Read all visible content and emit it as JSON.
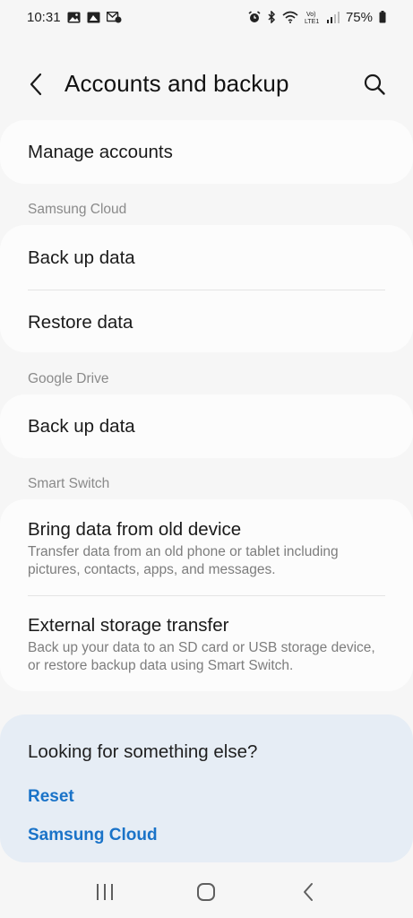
{
  "status_bar": {
    "time": "10:31",
    "battery": "75%",
    "left_icons": [
      "gallery-icon",
      "image-icon",
      "message-icon"
    ],
    "right_icons": [
      "alarm-icon",
      "bluetooth-icon",
      "wifi-icon",
      "volte-icon",
      "signal-icon",
      "battery-icon"
    ],
    "volte_text": "Vo)\nLTE1"
  },
  "header": {
    "title": "Accounts and backup"
  },
  "manage_accounts": {
    "label": "Manage accounts"
  },
  "samsung_cloud": {
    "section_label": "Samsung Cloud",
    "items": [
      {
        "label": "Back up data"
      },
      {
        "label": "Restore data"
      }
    ]
  },
  "google_drive": {
    "section_label": "Google Drive",
    "items": [
      {
        "label": "Back up data"
      }
    ]
  },
  "smart_switch": {
    "section_label": "Smart Switch",
    "items": [
      {
        "label": "Bring data from old device",
        "subtitle": "Transfer data from an old phone or tablet including pictures, contacts, apps, and messages."
      },
      {
        "label": "External storage transfer",
        "subtitle": "Back up your data to an SD card or USB storage device, or restore backup data using Smart Switch."
      }
    ]
  },
  "suggestions": {
    "title": "Looking for something else?",
    "links": [
      {
        "label": "Reset"
      },
      {
        "label": "Samsung Cloud"
      }
    ]
  },
  "colors": {
    "background": "#f6f6f6",
    "card": "#fcfcfc",
    "suggest_card": "#e6edf5",
    "link": "#1a73c8"
  }
}
